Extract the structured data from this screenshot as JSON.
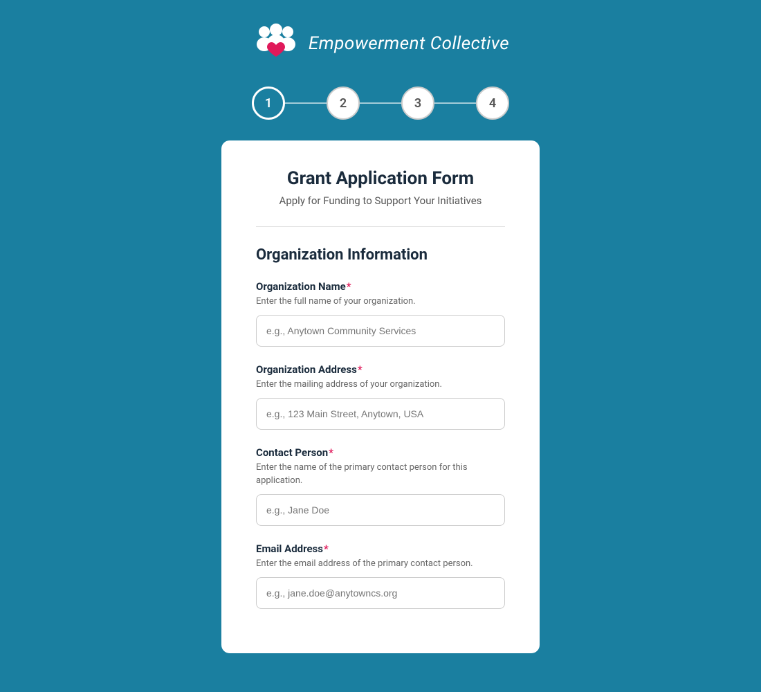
{
  "brand": {
    "name": "Empowerment Collective",
    "logo_alt": "Empowerment Collective Logo"
  },
  "steps": [
    {
      "number": "1",
      "active": true
    },
    {
      "number": "2",
      "active": false
    },
    {
      "number": "3",
      "active": false
    },
    {
      "number": "4",
      "active": false
    }
  ],
  "form": {
    "title": "Grant Application Form",
    "subtitle": "Apply for Funding to Support Your Initiatives",
    "section_title": "Organization Information",
    "fields": [
      {
        "id": "org-name",
        "label": "Organization Name",
        "required": true,
        "description": "Enter the full name of your organization.",
        "placeholder": "e.g., Anytown Community Services"
      },
      {
        "id": "org-address",
        "label": "Organization Address",
        "required": true,
        "description": "Enter the mailing address of your organization.",
        "placeholder": "e.g., 123 Main Street, Anytown, USA"
      },
      {
        "id": "contact-person",
        "label": "Contact Person",
        "required": true,
        "description": "Enter the name of the primary contact person for this application.",
        "placeholder": "e.g., Jane Doe"
      },
      {
        "id": "email-address",
        "label": "Email Address",
        "required": true,
        "description": "Enter the email address of the primary contact person.",
        "placeholder": "e.g., jane.doe@anytowncs.org"
      }
    ]
  },
  "colors": {
    "background": "#1a7fa0",
    "active_step": "#1a7fa0",
    "required_star": "#e0195a",
    "card_bg": "#ffffff"
  }
}
